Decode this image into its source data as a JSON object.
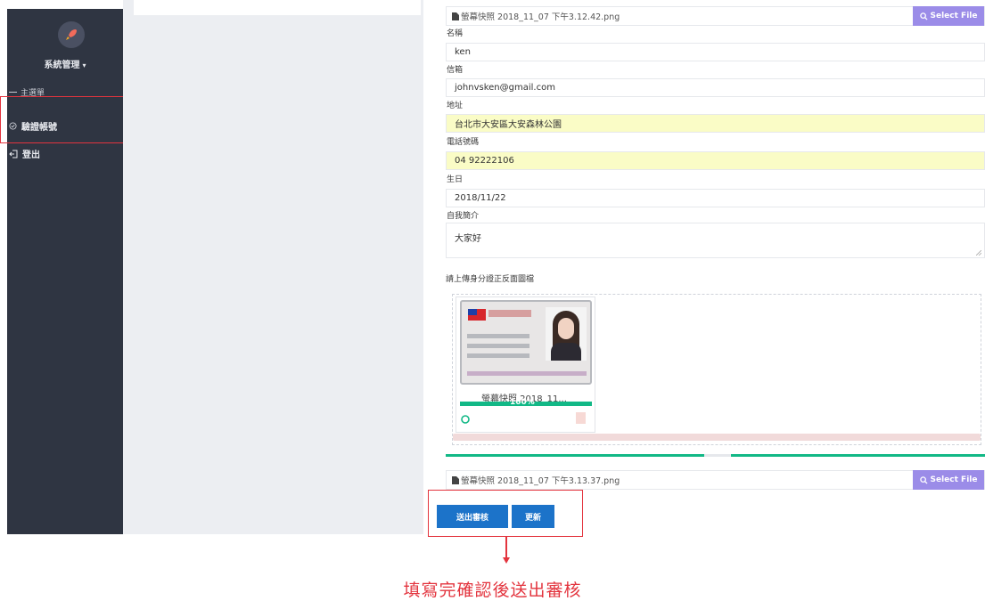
{
  "sidebar": {
    "org_name": "系統管理",
    "menu_header": "主選單",
    "items": [
      {
        "label": "驗證帳號",
        "icon": "check-circle-icon"
      },
      {
        "label": "登出",
        "icon": "logout-icon"
      }
    ]
  },
  "form": {
    "top_file": {
      "name": "螢幕快照 2018_11_07 下午3.12.42.png",
      "button": "Select File"
    },
    "fields": [
      {
        "label": "名稱",
        "value": "ken"
      },
      {
        "label": "信箱",
        "value": "johnvsken@gmail.com"
      },
      {
        "label": "地址",
        "value": "台北市大安區大安森林公園"
      },
      {
        "label": "電話號碼",
        "value": "04 92222106"
      },
      {
        "label": "生日",
        "value": "2018/11/22"
      }
    ],
    "intro": {
      "label": "自我簡介",
      "value": "大家好"
    },
    "upload": {
      "label": "請上傳身分證正反面圖檔",
      "thumb_name": "螢幕快照 2018_11...",
      "progress_text": "100%",
      "progress": 1.0,
      "file": {
        "name": "螢幕快照 2018_11_07 下午3.13.37.png",
        "button": "Select File"
      }
    },
    "buttons": {
      "submit": "送出審核",
      "update": "更新"
    }
  },
  "annotation": "填寫完確認後送出審核",
  "colors": {
    "sidebar": "#2f3542",
    "primary": "#1c73c9",
    "accent": "#9b8ce8",
    "highlight": "#e3343e",
    "success": "#12b886"
  }
}
